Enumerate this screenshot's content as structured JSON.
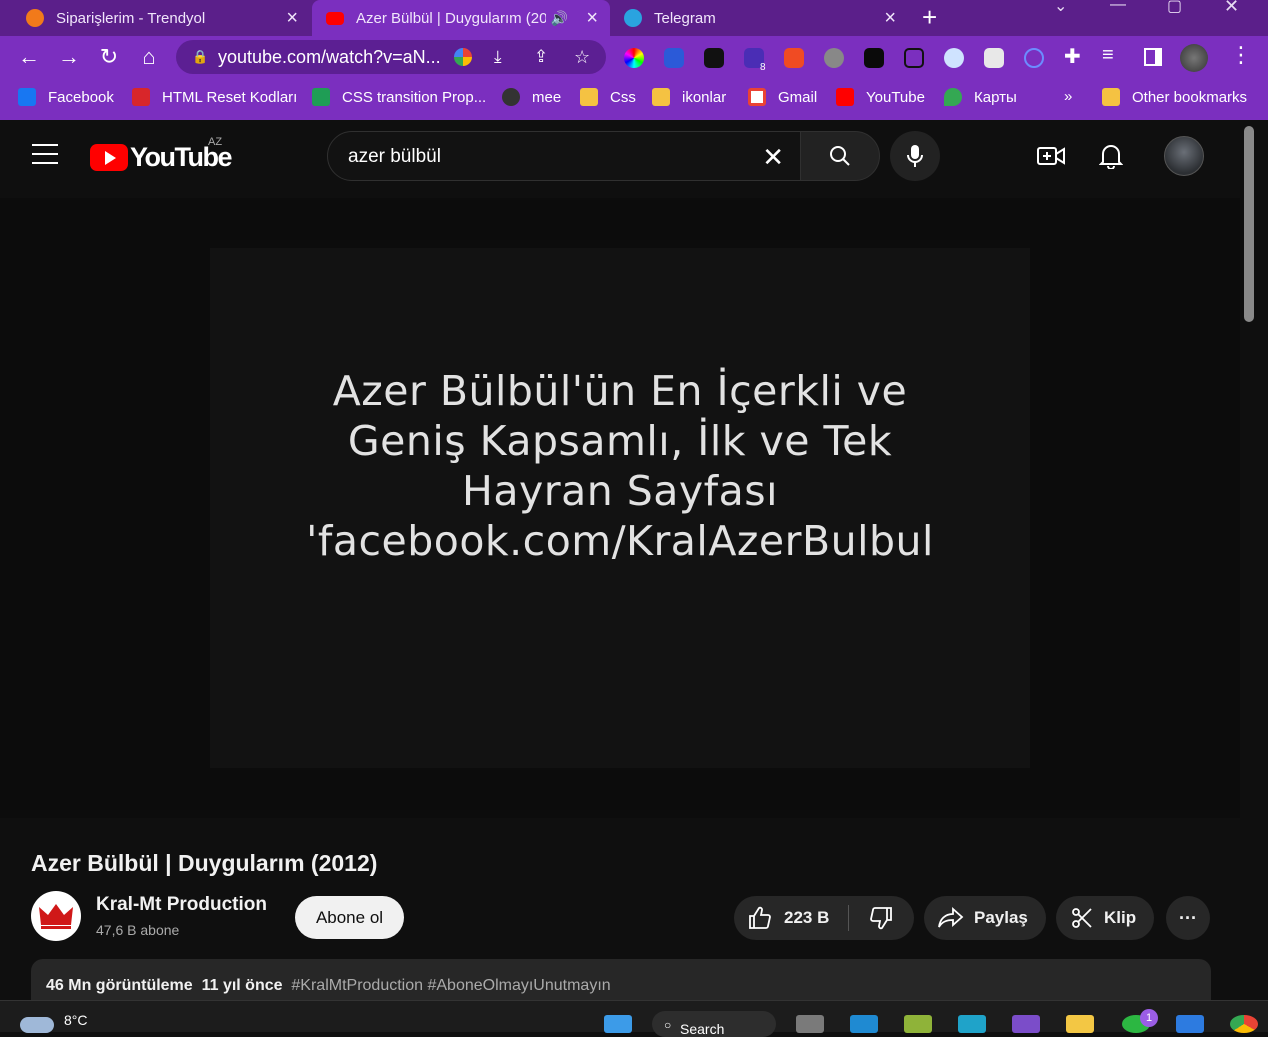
{
  "browser": {
    "tabs": [
      {
        "title": "Siparişlerim - Trendyol"
      },
      {
        "title": "Azer Bülbül | Duygularım (20"
      },
      {
        "title": "Telegram"
      }
    ],
    "new_tab_label": "+",
    "url": "youtube.com/watch?v=aN...",
    "bookmarks": [
      {
        "label": "Facebook"
      },
      {
        "label": "HTML Reset Kodları"
      },
      {
        "label": "CSS transition Prop..."
      },
      {
        "label": "mee"
      },
      {
        "label": "Css"
      },
      {
        "label": "ikonlar"
      },
      {
        "label": "Gmail"
      },
      {
        "label": "YouTube"
      },
      {
        "label": "Карты"
      }
    ],
    "bookmarks_overflow": "»",
    "other_bookmarks": "Other bookmarks",
    "extension_badge": "8",
    "colors": {
      "frame": "#5b1f8a",
      "toolbar": "#7b2fbf",
      "omnibox": "#5c1f93"
    }
  },
  "youtube": {
    "logo_text": "YouTube",
    "country_code": "AZ",
    "search_query": "azer bülbül",
    "video_overlay_lines": [
      "Azer Bülbül'ün En İçerkli ve",
      "Geniş Kapsamlı, İlk ve Tek",
      "Hayran Sayfası",
      "'facebook.com/KralAzerBulbul"
    ],
    "video_title": "Azer Bülbül | Duygularım (2012)",
    "channel": {
      "name": "Kral-Mt Production",
      "subscribers": "47,6 B abone"
    },
    "subscribe_label": "Abone ol",
    "like_count": "223 B",
    "share_label": "Paylaş",
    "clip_label": "Klip",
    "more_label": "···",
    "views": "46 Mn görüntüleme",
    "age": "11 yıl önce",
    "hashtags": "#KralMtProduction #AboneOlmayıUnutmayın",
    "colors": {
      "brand": "#ff0000",
      "bg": "#0f0f0f",
      "pill": "#272727"
    }
  },
  "taskbar": {
    "temperature": "8°C",
    "search_label": "Search",
    "notification_count": "1"
  }
}
